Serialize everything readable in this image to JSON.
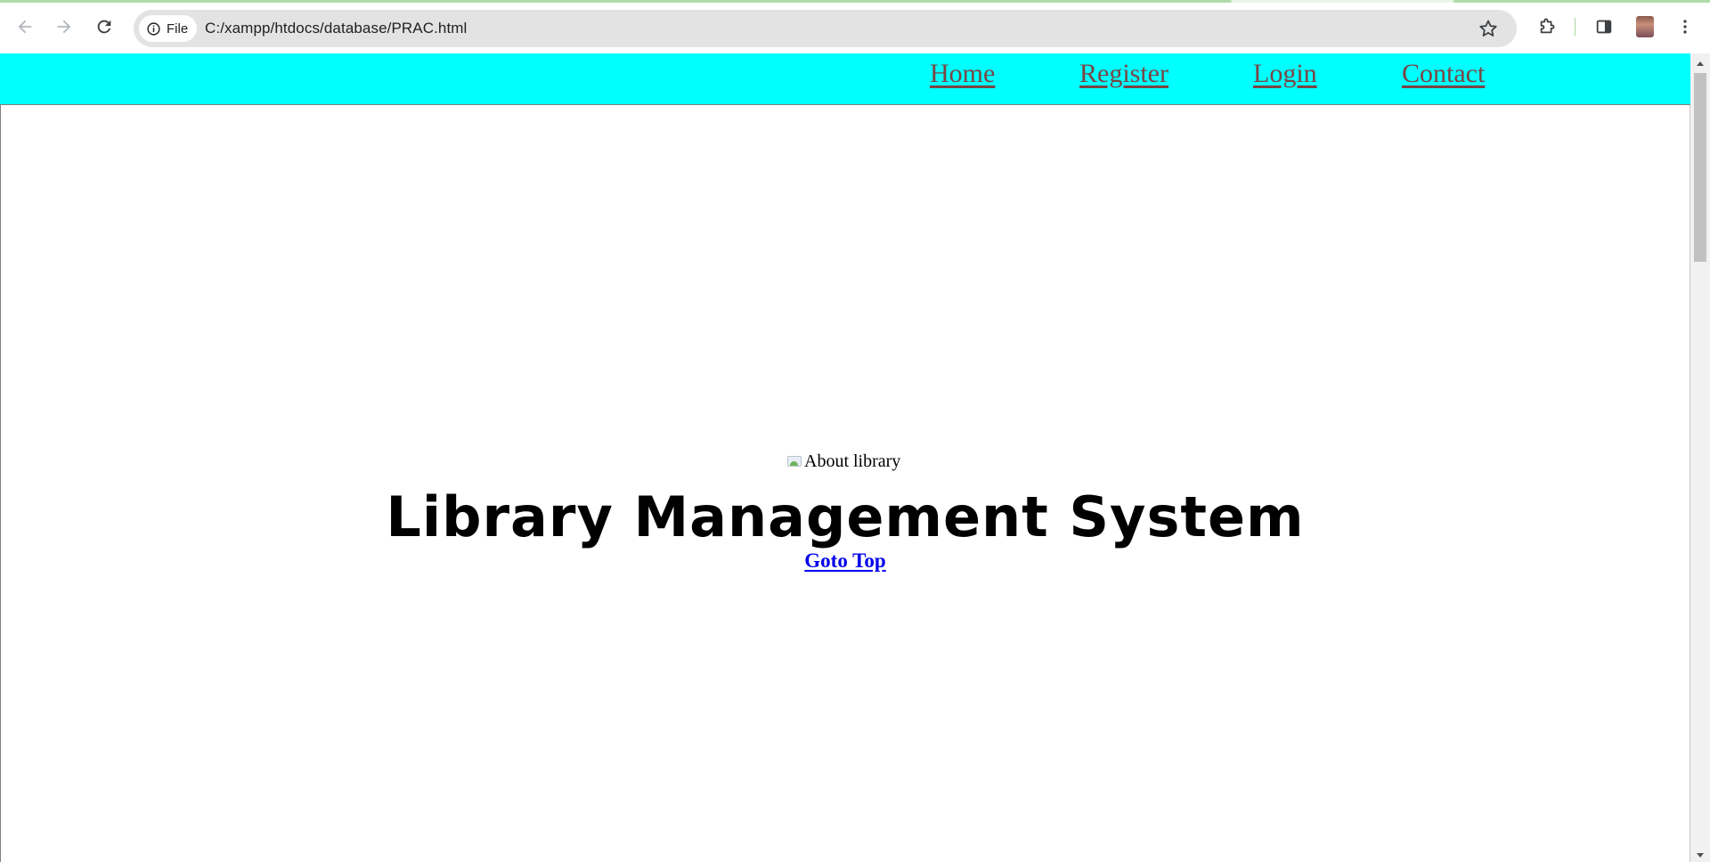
{
  "browser": {
    "site_chip_label": "File",
    "url": "C:/xampp/htdocs/database/PRAC.html",
    "icons": {
      "back": "arrow-left-icon",
      "forward": "arrow-right-icon",
      "reload": "reload-icon",
      "site_info": "info-icon",
      "bookmark": "star-icon",
      "extensions": "puzzle-icon",
      "side_panel": "side-panel-icon",
      "menu": "kebab-menu-icon"
    }
  },
  "page": {
    "nav": {
      "background": "#00ffff",
      "link_color": "#7a4545",
      "links": [
        "Home",
        "Register",
        "Login",
        "Contact"
      ]
    },
    "image_alt": "About library",
    "title": "Library Management System",
    "goto_top": "Goto Top",
    "link_color": "#0000ee"
  }
}
